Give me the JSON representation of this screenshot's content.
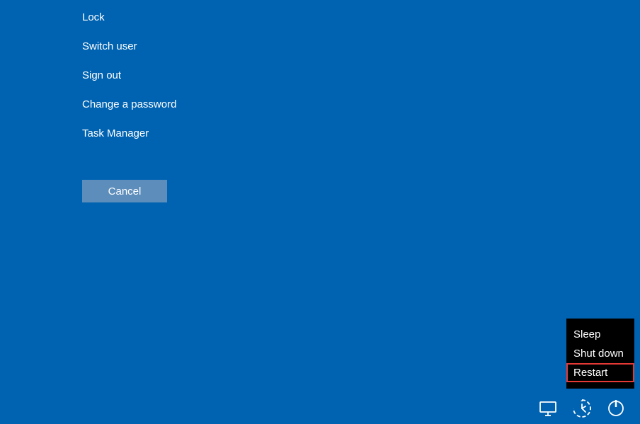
{
  "menu": {
    "items": [
      {
        "label": "Lock"
      },
      {
        "label": "Switch user"
      },
      {
        "label": "Sign out"
      },
      {
        "label": "Change a password"
      },
      {
        "label": "Task Manager"
      }
    ],
    "cancel_label": "Cancel"
  },
  "power_menu": {
    "items": [
      {
        "label": "Sleep",
        "highlighted": false
      },
      {
        "label": "Shut down",
        "highlighted": false
      },
      {
        "label": "Restart",
        "highlighted": true
      }
    ]
  },
  "icons": {
    "network": "network-icon",
    "accessibility": "ease-of-access-icon",
    "power": "power-icon"
  }
}
